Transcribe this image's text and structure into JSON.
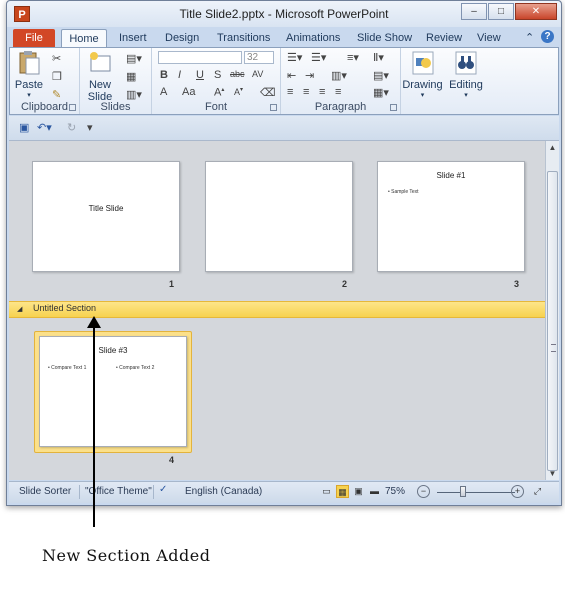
{
  "window": {
    "title": "Title Slide2.pptx - Microsoft PowerPoint",
    "app_icon_letter": "P",
    "buttons": [
      "minimize-icon",
      "restore-icon",
      "close-icon"
    ]
  },
  "tabs": {
    "file": "File",
    "items": [
      "Home",
      "Insert",
      "Design",
      "Transitions",
      "Animations",
      "Slide Show",
      "Review",
      "View"
    ],
    "active": "Home"
  },
  "ribbon": {
    "clipboard": {
      "label": "Clipboard",
      "paste": "Paste"
    },
    "slides": {
      "label": "Slides",
      "new_slide_line1": "New",
      "new_slide_line2": "Slide"
    },
    "font": {
      "label": "Font",
      "size": "32"
    },
    "paragraph": {
      "label": "Paragraph"
    },
    "drawing": {
      "label": "Drawing"
    },
    "editing": {
      "label": "Editing"
    }
  },
  "slides": [
    {
      "number": "1",
      "title": "Title Slide"
    },
    {
      "number": "2",
      "title": ""
    },
    {
      "number": "3",
      "title": "Slide #1",
      "bullet": "Sample Text"
    },
    {
      "number": "4",
      "title": "Slide #3",
      "bullets": [
        "Compare Text 1",
        "Compare Text 2"
      ]
    }
  ],
  "section": {
    "name": "Untitled Section"
  },
  "statusbar": {
    "view": "Slide Sorter",
    "theme": "\"Office Theme\"",
    "language": "English (Canada)",
    "zoom": "75%",
    "zoom_level": 0.5
  },
  "annotation": {
    "caption": "New Section Added"
  },
  "colors": {
    "file_tab": "#d24726",
    "section_highlight": "#f7d24f",
    "ribbon": "#e3ebf6"
  }
}
